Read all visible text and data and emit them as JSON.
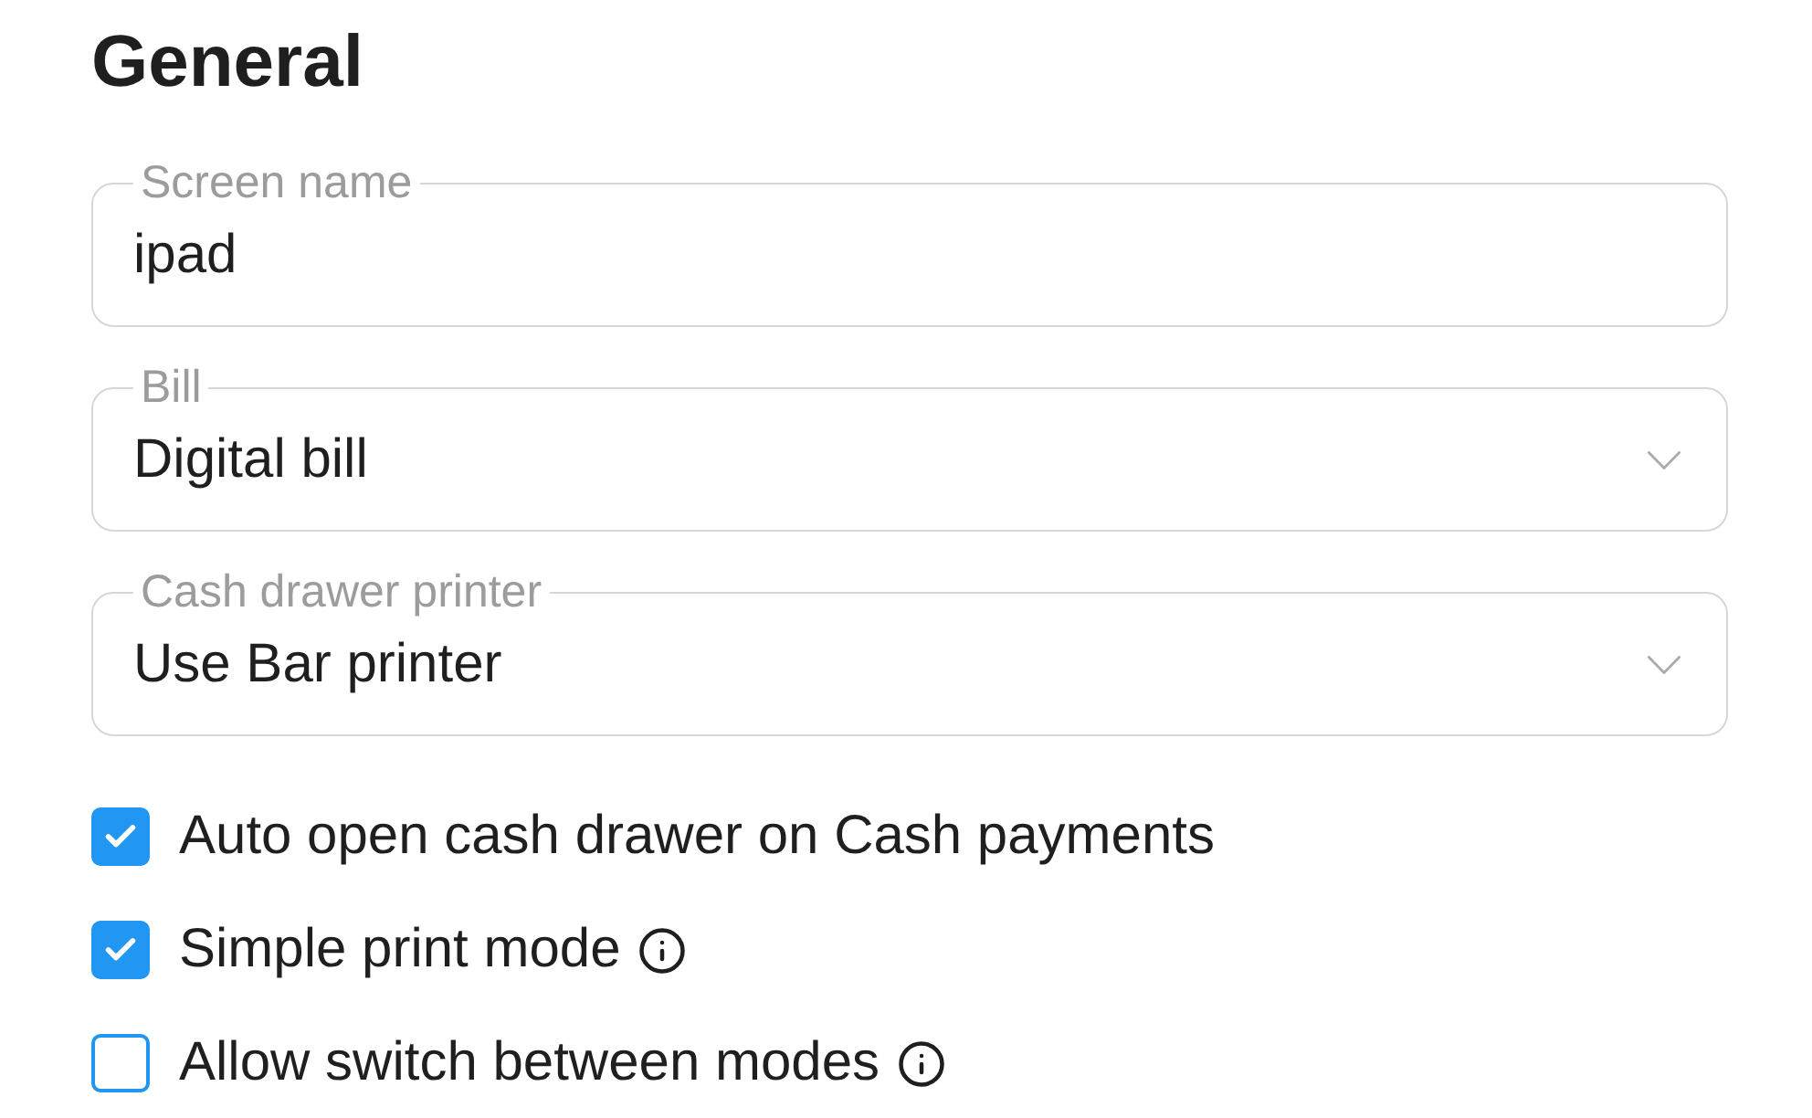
{
  "heading": "General",
  "fields": [
    {
      "kind": "text",
      "label": "Screen name",
      "value": "ipad"
    },
    {
      "kind": "select",
      "label": "Bill",
      "value": "Digital bill"
    },
    {
      "kind": "select",
      "label": "Cash drawer printer",
      "value": "Use Bar printer"
    }
  ],
  "options": [
    {
      "label": "Auto open cash drawer on Cash payments",
      "checked": true,
      "info": false
    },
    {
      "label": "Simple print mode",
      "checked": true,
      "info": true
    },
    {
      "label": "Allow switch between modes",
      "checked": false,
      "info": true
    }
  ]
}
